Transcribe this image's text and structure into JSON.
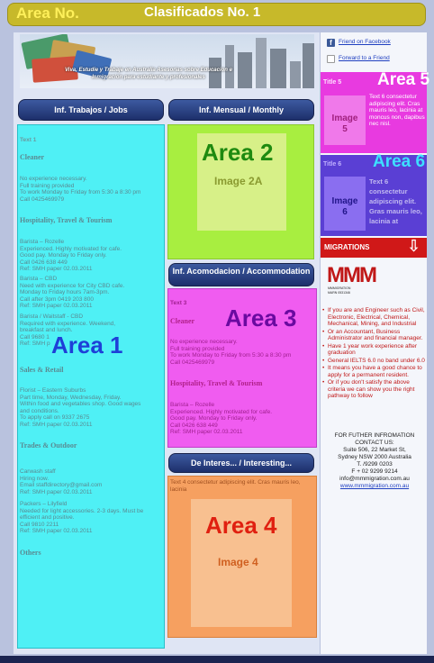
{
  "header": {
    "area_label": "Area No.",
    "title": "Clasificados No. 1"
  },
  "banner": {
    "text": "Viva, Estudie y Trabaje en Australia Asesorias sobre Educacion e Inmigracion para estudiante y profesionales"
  },
  "tabs": {
    "jobs": "Inf. Trabajos / Jobs",
    "monthly": "Inf. Mensual / Monthly",
    "accommodation": "Inf. Acomodacion / Accommodation",
    "interesting": "De Interes... / Interesting..."
  },
  "area1": {
    "label": "Area 1",
    "text_label": "Text 1",
    "cat_cleaner": "Cleaner",
    "cleaner_text": "No experience necessary.\nFull training provided\nTo work Monday to Friday from 5:30 a 8:30 pm\nCall 0425469979",
    "cat_hosp": "Hospitality, Travel & Tourism",
    "job1": "Barista – Rozelle\nExperienced. Highly motivated for cafe.\nGood pay. Monday to Friday only.\nCall 0426 638 449\nRef: SMH paper 02.03.2011",
    "job2": "Barista – CBD\nNeed with experience for City CBD cafe.\nMonday to Friday hours 7am-3pm.\nCall after 3pm 0419 203 800\nRef: SMH paper 02.03.2011",
    "job3": "Barista / Waitstaff - CBD\nRequired with experience. Weekend,\nbreakfast and lunch.\nCall 9680 1\nRef: SMH p",
    "cat_sales": "Sales & Retail",
    "job4": "Florist – Eastern Suburbs\nPart time, Monday, Wednesday, Friday.\nWithin food and vegetables shop. Good wages\nand conditions.\nTo apply call on 9337 2675\nRef: SMH paper 02.03.2011",
    "cat_trades": "Trades & Outdoor",
    "job5": "Carwash staff\nHiring now.\nEmail staffdirectory@gmail.com\nRef: SMH paper 02.03.2011",
    "job6": "Packers – Lilyfield\nNeeded for light accessories. 2-3 days. Must be\nefficient and positive.\nCall 9810 2211\nRef: SMH paper 02.03.2011",
    "cat_others": "Others"
  },
  "area2": {
    "label": "Area 2",
    "image": "Image 2A"
  },
  "area3": {
    "label": "Area 3",
    "text_label": "Text 3",
    "cat_cleaner": "Cleaner",
    "cleaner_text": "No experience necessary.\nFull training provided\nTo work Monday to Friday from 5:30 a 8:30 pm\nCall 0425469979",
    "cat_hosp": "Hospitality, Travel & Tourism",
    "job1": "Barista – Rozelle\nExperienced. Highly motivated for cafe.\nGood pay. Monday to Friday only.\nCall 0426 638 449\nRef: SMH paper 02.03.2011"
  },
  "area4": {
    "label": "Area 4",
    "image": "Image 4",
    "text": "Text 4 consectetur adipiscing elit. Cras mauris leo, lacinia"
  },
  "right": {
    "facebook": "Friend on Facebook",
    "forward": "Forward to a Friend",
    "area5": {
      "label": "Area 5",
      "title": "Title 5",
      "image": "Image\n5",
      "text": "Text 6 consectetur adipiscing elit. Cras mauris leo, lacinia at moncus non, dapibus nec nisl."
    },
    "area6": {
      "label": "Area 6",
      "title": "Title 6",
      "image": "Image\n6",
      "text": "Text 6\nconsectetur\nadipiscing elit.\nGras mauris leo,\nlacinia at"
    },
    "migrations": "MIGRATIONS",
    "logo": "MMM",
    "logo_sub": "MMMIGRATION\nMARN 0531346",
    "bullets": [
      "If you are and Engineer such as Civil, Electronic, Electrical, Chemical, Mechanical, Mining, and Industrial",
      "Or an Accountant, Business Administrator and financial manager.",
      "Have 1 year work experience after graduation",
      "General IELTS 6.0 no band under 6.0",
      "It means you have a good chance to apply for a permanent resident.",
      "Or if you don't satisfy the above criteria we can show you the right pathway to follow"
    ],
    "contact_title": "FOR FUTHER INFROMATION CONTACT US:",
    "address": "Suite 506, 22 Market St,\nSydney NSW 2000 Australia",
    "phone": "T. /9299 0203",
    "fax": "F + 02 9299 9214",
    "email": "info@mmmigration.com.au",
    "website": "www.mmmigration.com.au"
  },
  "colors": {
    "area1": "#4ff0f5",
    "area2": "#a8ee40",
    "area3": "#f05cf0",
    "area4": "#f6a060",
    "area5": "#e83ae0",
    "area6": "#5a3fd4",
    "header": "#c7b92a"
  }
}
